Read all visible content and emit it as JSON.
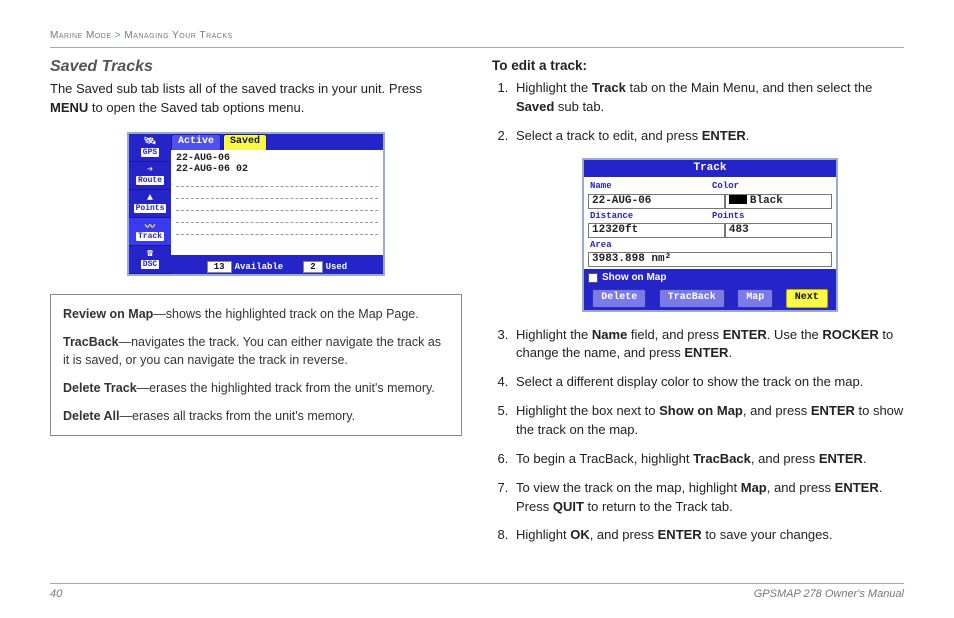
{
  "header": {
    "section": "Marine Mode",
    "sep": ">",
    "sub": "Managing Your Tracks"
  },
  "left": {
    "title": "Saved Tracks",
    "intro1": "The Saved sub tab lists all of the saved tracks in your unit. Press ",
    "intro_menu": "MENU",
    "intro2": " to open the Saved tab options menu."
  },
  "device1": {
    "sidebar": [
      "GPS",
      "Route",
      "Points",
      "Track",
      "DSC"
    ],
    "tabs": {
      "active": "Active",
      "saved": "Saved"
    },
    "items": [
      "22-AUG-06",
      "22-AUG-06 02"
    ],
    "foot": {
      "avail_n": "13",
      "avail_l": "Available",
      "used_n": "2",
      "used_l": "Used"
    }
  },
  "options": {
    "review_b": "Review on Map",
    "review": "—shows the highlighted track on the Map Page.",
    "tracback_b": "TracBack",
    "tracback": "—navigates the track. You can either navigate the track as it is saved, or you can navigate the track in reverse.",
    "delete_b": "Delete Track",
    "delete": "—erases the highlighted track from the unit's memory.",
    "deleteall_b": "Delete All",
    "deleteall": "—erases all tracks from the unit's memory."
  },
  "right": {
    "title": "To edit a track:",
    "steps": {
      "s1a": "Highlight the ",
      "s1b": "Track",
      "s1c": " tab on the Main Menu, and then select the ",
      "s1d": "Saved",
      "s1e": " sub tab.",
      "s2a": "Select a track to edit, and press ",
      "s2b": "ENTER",
      "s2c": ".",
      "s3a": "Highlight the ",
      "s3b": "Name",
      "s3c": " field, and press ",
      "s3d": "ENTER",
      "s3e": ". Use the ",
      "s3f": "ROCKER",
      "s3g": " to change the name, and press ",
      "s3h": "ENTER",
      "s3i": ".",
      "s4": "Select a different display color to show the track on the map.",
      "s5a": "Highlight the box next to ",
      "s5b": "Show on Map",
      "s5c": ", and press ",
      "s5d": "ENTER",
      "s5e": " to show the track on the map.",
      "s6a": "To begin a TracBack, highlight ",
      "s6b": "TracBack",
      "s6c": ", and press ",
      "s6d": "ENTER",
      "s6e": ".",
      "s7a": "To view the track on the map, highlight ",
      "s7b": "Map",
      "s7c": ", and press ",
      "s7d": "ENTER",
      "s7e": ". Press ",
      "s7f": "QUIT",
      "s7g": " to return to the Track tab.",
      "s8a": "Highlight ",
      "s8b": "OK",
      "s8c": ", and press ",
      "s8d": "ENTER",
      "s8e": " to save your changes."
    }
  },
  "device2": {
    "title": "Track",
    "labels": {
      "name": "Name",
      "color": "Color",
      "distance": "Distance",
      "points": "Points",
      "area": "Area"
    },
    "values": {
      "name": "22-AUG-06",
      "color": "Black",
      "distance": "12320ft",
      "points": "483",
      "area": "3983.898  nm²"
    },
    "show": "Show on Map",
    "buttons": {
      "delete": "Delete",
      "tracback": "TracBack",
      "map": "Map",
      "next": "Next"
    }
  },
  "footer": {
    "page": "40",
    "doc": "GPSMAP 278 Owner's Manual"
  }
}
